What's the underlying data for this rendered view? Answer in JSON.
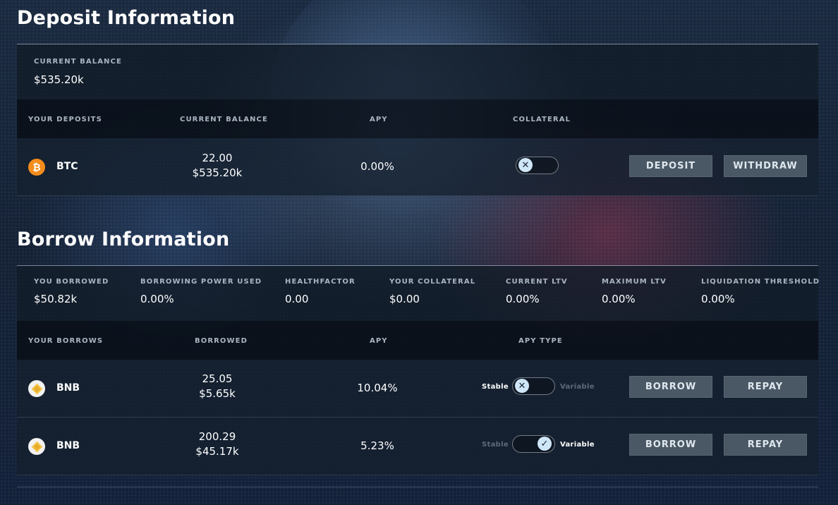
{
  "deposit": {
    "title": "Deposit Information",
    "summary": {
      "label": "CURRENT BALANCE",
      "value": "$535.20k"
    },
    "columns": [
      "YOUR DEPOSITS",
      "CURRENT BALANCE",
      "APY",
      "COLLATERAL"
    ],
    "rows": [
      {
        "symbol": "BTC",
        "amount": "22.00",
        "usd": "$535.20k",
        "apy": "0.00%",
        "collateral_enabled": false,
        "deposit_label": "DEPOSIT",
        "withdraw_label": "WITHDRAW"
      }
    ]
  },
  "borrow": {
    "title": "Borrow Information",
    "stats": [
      {
        "label": "YOU BORROWED",
        "value": "$50.82k"
      },
      {
        "label": "BORROWING POWER USED",
        "value": "0.00%"
      },
      {
        "label": "HEALTHFACTOR",
        "value": "0.00"
      },
      {
        "label": "YOUR COLLATERAL",
        "value": "$0.00"
      },
      {
        "label": "CURRENT LTV",
        "value": "0.00%"
      },
      {
        "label": "MAXIMUM LTV",
        "value": "0.00%"
      },
      {
        "label": "LIQUIDATION THRESHOLD",
        "value": "0.00%"
      }
    ],
    "columns": [
      "YOUR BORROWS",
      "BORROWED",
      "APY",
      "APY TYPE"
    ],
    "rows": [
      {
        "symbol": "BNB",
        "amount": "25.05",
        "usd": "$5.65k",
        "apy": "10.04%",
        "apy_type": "Stable",
        "stable_label": "Stable",
        "variable_label": "Variable",
        "borrow_label": "BORROW",
        "repay_label": "REPAY"
      },
      {
        "symbol": "BNB",
        "amount": "200.29",
        "usd": "$45.17k",
        "apy": "5.23%",
        "apy_type": "Variable",
        "stable_label": "Stable",
        "variable_label": "Variable",
        "borrow_label": "BORROW",
        "repay_label": "REPAY"
      }
    ]
  },
  "icons": {
    "btc": "bitcoin-icon",
    "bnb": "bnb-icon",
    "toggle_off": "close-icon",
    "toggle_on": "check-icon"
  },
  "colors": {
    "btc": "#f38c1b",
    "bnb": "#e6ac2c",
    "button": "#4a5865",
    "knob": "#cfe6f7"
  }
}
